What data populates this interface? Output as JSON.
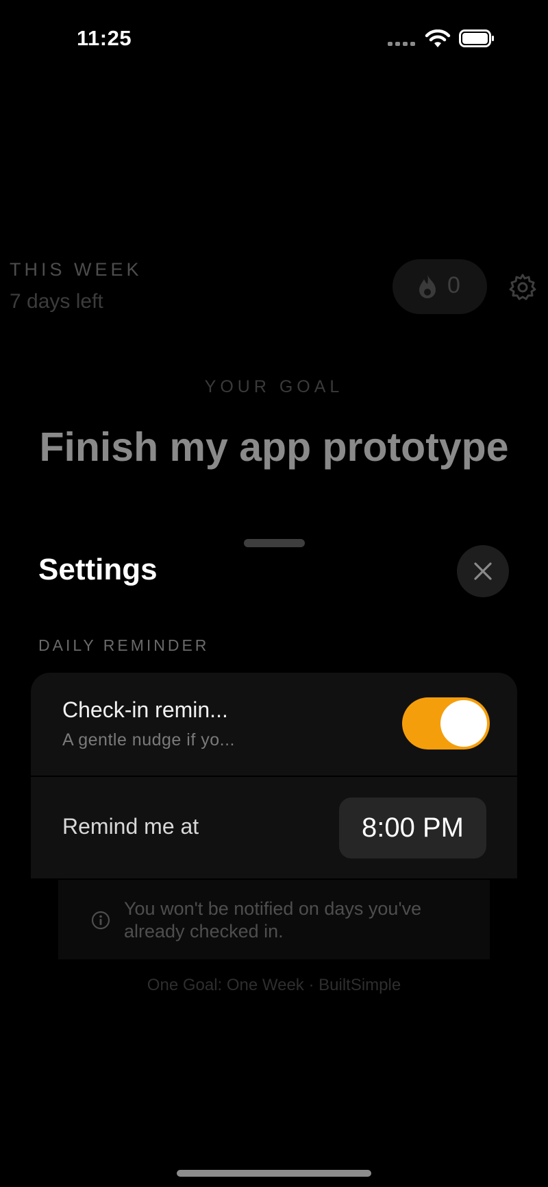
{
  "status_bar": {
    "time": "11:25"
  },
  "background": {
    "week_label": "THIS WEEK",
    "days_left": "7 days left",
    "streak_count": "0",
    "goal_label": "YOUR GOAL",
    "goal_text": "Finish my app prototype"
  },
  "sheet": {
    "title": "Settings",
    "section_label": "DAILY REMINDER",
    "reminder_row": {
      "title": "Check-in remin...",
      "subtitle": "A gentle nudge if yo...",
      "toggle_on": true
    },
    "time_row": {
      "label": "Remind me at",
      "time": "8:00 PM"
    },
    "info_text": "You won't be notified on days you've already checked in.",
    "footer": "One Goal: One Week · BuiltSimple"
  },
  "colors": {
    "accent": "#f59e0b",
    "background": "#000000",
    "card": "#111111"
  }
}
